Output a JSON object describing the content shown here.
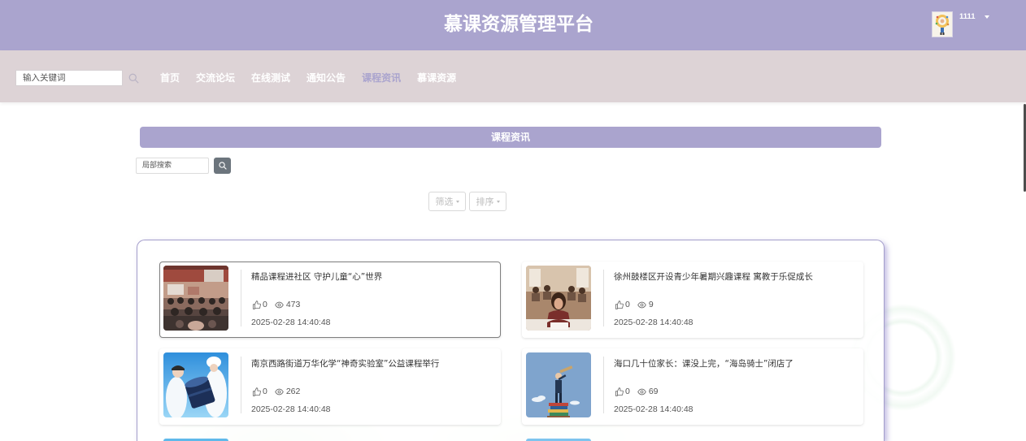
{
  "header": {
    "title": "慕课资源管理平台",
    "username": "1111"
  },
  "nav": {
    "search_placeholder": "输入关键词",
    "items": [
      {
        "label": "首页",
        "active": false
      },
      {
        "label": "交流论坛",
        "active": false
      },
      {
        "label": "在线测试",
        "active": false
      },
      {
        "label": "通知公告",
        "active": false
      },
      {
        "label": "课程资讯",
        "active": true
      },
      {
        "label": "慕课资源",
        "active": false
      }
    ]
  },
  "page": {
    "title": "课程资讯",
    "local_search_placeholder": "局部搜索",
    "filter_label": "筛选",
    "sort_label": "排序"
  },
  "news": [
    {
      "title": "精品课程进社区 守护儿童“心”世界",
      "likes": 0,
      "views": 473,
      "date": "2025-02-28 14:40:48"
    },
    {
      "title": "徐州鼓楼区开设青少年暑期兴趣课程 寓教于乐促成长",
      "likes": 0,
      "views": 9,
      "date": "2025-02-28 14:40:48"
    },
    {
      "title": "南京西路街道万华化学“神奇实验室”公益课程举行",
      "likes": 0,
      "views": 262,
      "date": "2025-02-28 14:40:48"
    },
    {
      "title": "海口几十位家长：课没上完，“海岛骑士”闭店了",
      "likes": 0,
      "views": 69,
      "date": "2025-02-28 14:40:48"
    }
  ],
  "icons": {
    "search": "search-icon",
    "like": "thumbs-up-icon",
    "views": "eye-icon",
    "dropdown": "caret-down-icon"
  },
  "colors": {
    "header_bg": "#aaa4ce",
    "nav_bg": "#ddd3d6",
    "accent": "#aaa4ce",
    "nav_text": "#ffffff",
    "search_button_bg": "#6c757d"
  }
}
